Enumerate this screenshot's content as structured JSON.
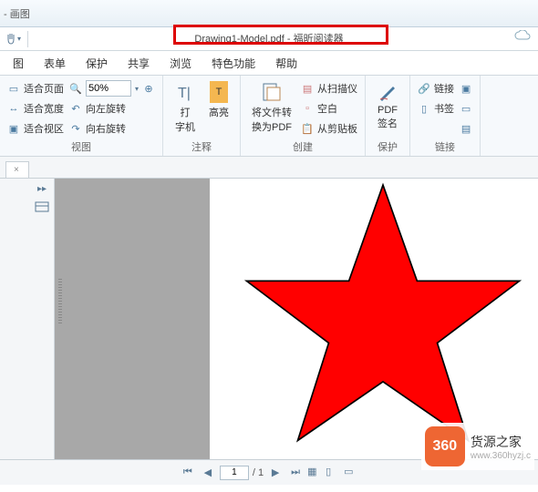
{
  "titlebar": {
    "partial_left": "- 画图",
    "center": "Drawing1-Model.pdf - 福昕阅读器"
  },
  "quickbar": {
    "hand": "✋"
  },
  "menu": {
    "items": [
      "图",
      "表单",
      "保护",
      "共享",
      "浏览",
      "特色功能",
      "帮助"
    ]
  },
  "ribbon": {
    "view": {
      "label": "视图",
      "fit_page": "适合页面",
      "fit_width": "适合宽度",
      "fit_view": "适合视区",
      "rotate_left": "向左旋转",
      "rotate_right": "向右旋转",
      "zoom": "50%"
    },
    "annotate": {
      "label": "注释",
      "typewriter": "打\n字机",
      "highlight": "高亮"
    },
    "create": {
      "label": "创建",
      "convert": "将文件转\n换为PDF",
      "from_scanner": "从扫描仪",
      "blank": "空白",
      "from_clipboard": "从剪贴板"
    },
    "protect": {
      "label": "保护",
      "pdf_sign": "PDF\n签名"
    },
    "links": {
      "label": "链接",
      "link": "链接",
      "bookmark": "书签"
    }
  },
  "tab": {
    "close": "×"
  },
  "status": {
    "page_current": "1",
    "page_total": "/ 1"
  },
  "watermark": {
    "badge": "360",
    "title": "货源之家",
    "url": "www.360hyzj.c"
  }
}
